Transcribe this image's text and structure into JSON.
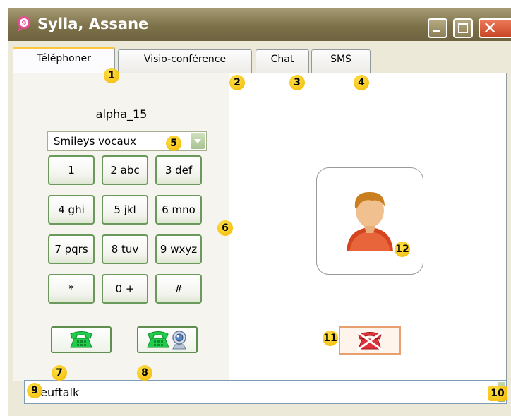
{
  "window": {
    "title": "Sylla, Assane",
    "app_icon": "neuftalk-logo-icon",
    "controls": [
      "minimize-icon",
      "maximize-icon",
      "close-icon"
    ]
  },
  "tabs": [
    {
      "label": "Téléphoner",
      "active": true
    },
    {
      "label": "Visio-conférence",
      "active": false
    },
    {
      "label": "Chat",
      "active": false
    },
    {
      "label": "SMS",
      "active": false
    }
  ],
  "contact": {
    "name": "alpha_15"
  },
  "smileys": {
    "selected": "Smileys vocaux"
  },
  "keypad": [
    "1",
    "2 abc",
    "3 def",
    "4 ghi",
    "5 jkl",
    "6 mno",
    "7 pqrs",
    "8 tuv",
    "9 wxyz",
    "*",
    "0 +",
    "#"
  ],
  "buttons": {
    "call_icon": "green-phone-icon",
    "video_call_icon": "phone-webcam-icon",
    "hangup_icon": "red-hangup-phone-icon",
    "avatar_icon": "user-avatar-icon"
  },
  "status_bar": {
    "text": "neuftalk"
  },
  "annotations": [
    "1",
    "2",
    "3",
    "4",
    "5",
    "6",
    "7",
    "8",
    "9",
    "10",
    "11",
    "12"
  ],
  "colors": {
    "titlebar": "#7d7149",
    "badge": "#f2b600",
    "key_border": "#6a9a5b",
    "phone_green": "#1fcc4b",
    "hangup_red": "#e0303a"
  }
}
